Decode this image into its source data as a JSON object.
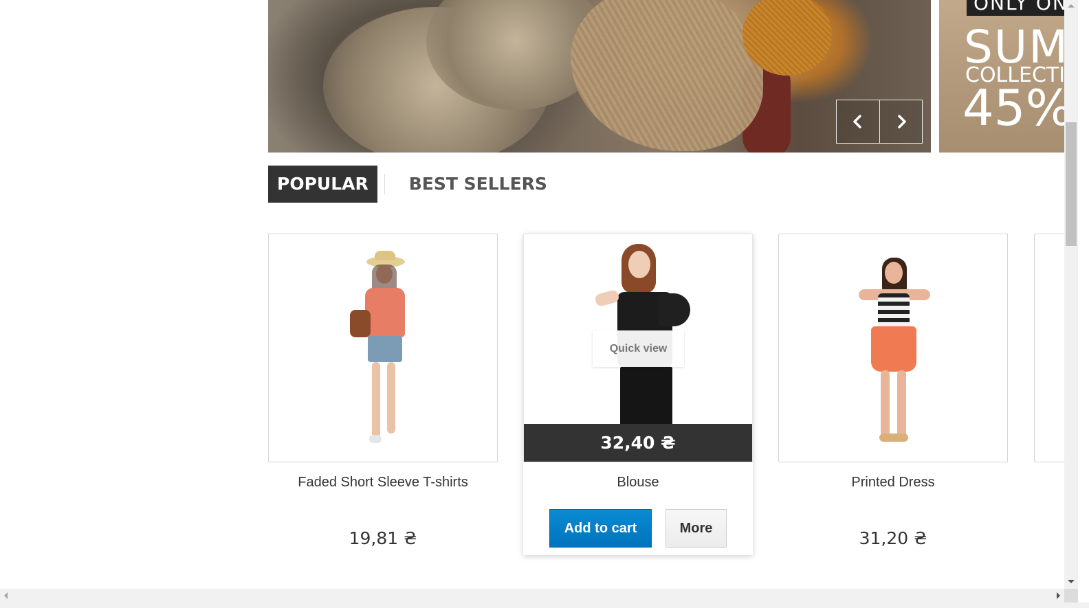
{
  "slider": {
    "prev_label": "‹",
    "next_label": "›"
  },
  "banner": {
    "tag": "ONLY ON",
    "headline": "SUM",
    "subline": "COLLECTIO",
    "discount": "45%"
  },
  "tabs": [
    {
      "label": "POPULAR",
      "active": true
    },
    {
      "label": "BEST SELLERS",
      "active": false
    }
  ],
  "products": [
    {
      "name": "Faded Short Sleeve T-shirts",
      "price": "19,81 ₴"
    },
    {
      "name": "Blouse",
      "price": "32,40 ₴",
      "quick_view": "Quick view",
      "add_to_cart": "Add to cart",
      "more": "More"
    },
    {
      "name": "Printed Dress",
      "price": "31,20 ₴"
    }
  ]
}
